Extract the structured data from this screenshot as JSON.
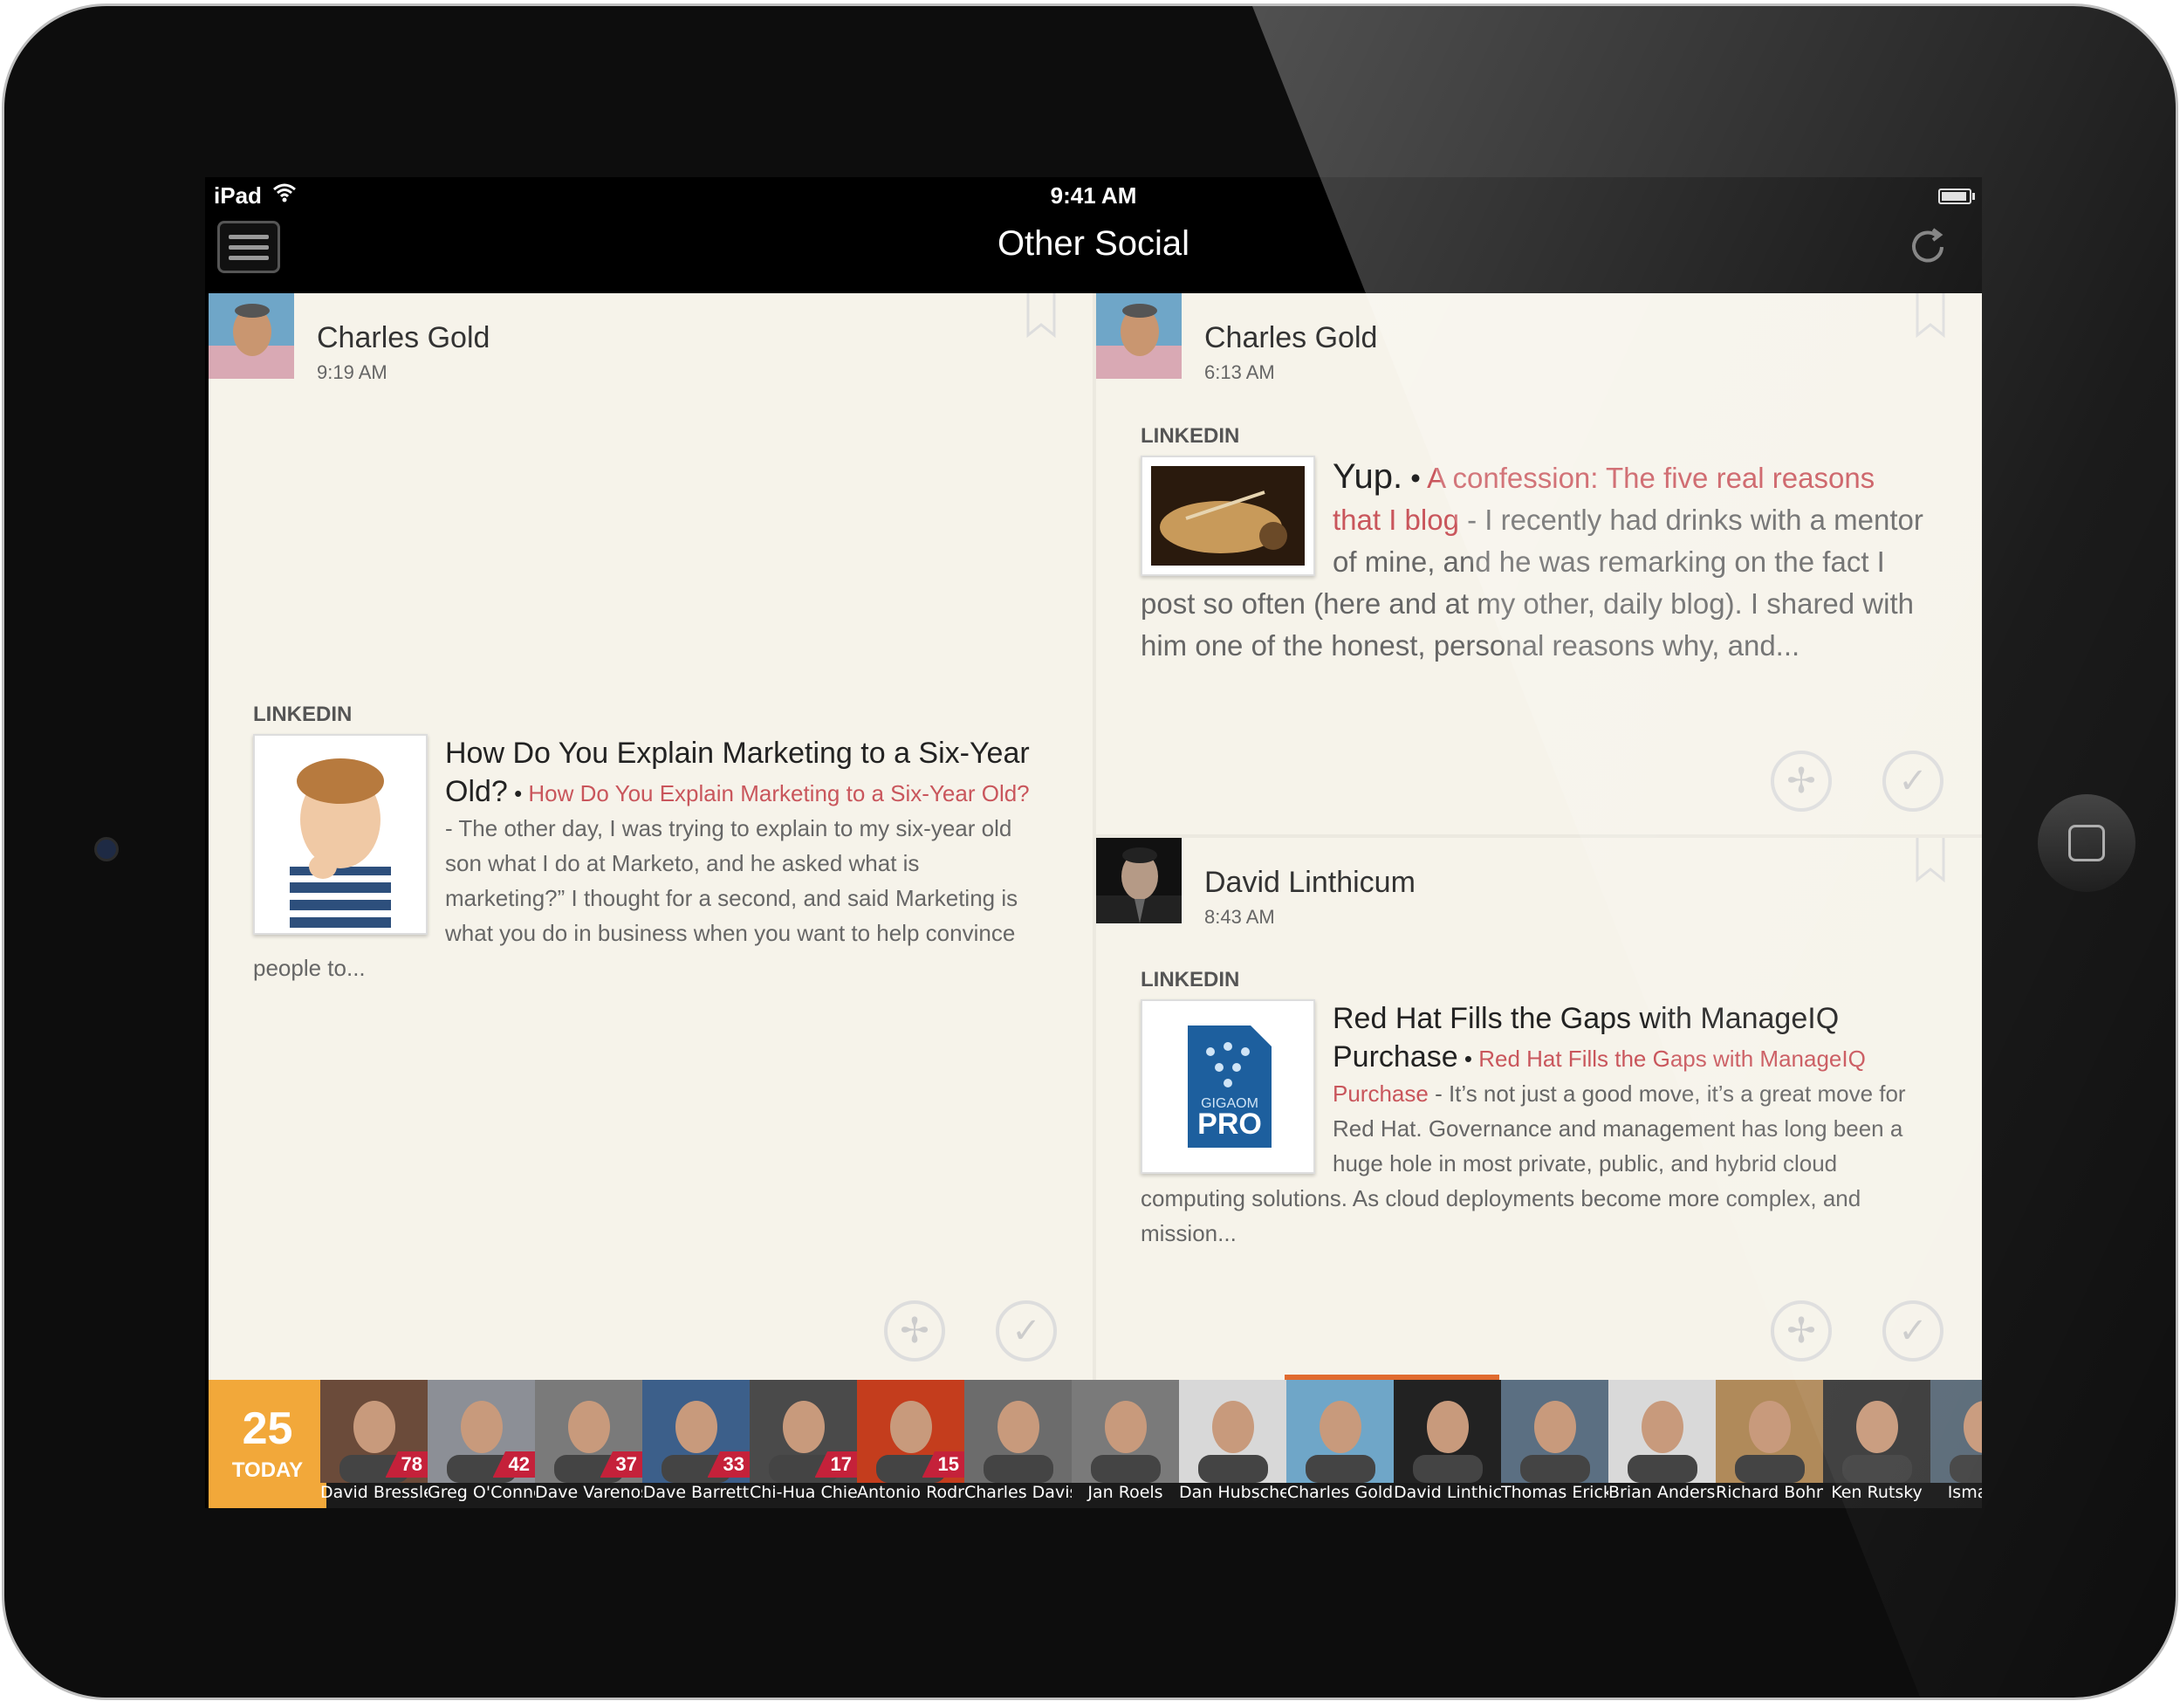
{
  "status_bar": {
    "carrier": "iPad",
    "time": "9:41 AM"
  },
  "nav": {
    "title": "Other Social"
  },
  "posts": [
    {
      "author": "Charles Gold",
      "time": "9:19 AM",
      "source": "LINKEDIN",
      "title": "How Do You Explain Marketing to a Six-Year Old?",
      "link": "How Do You Explain Marketing to a Six-Year Old?",
      "excerpt": " - The other day, I was trying to explain to my six-year old son what I do at Marketo, and he asked what is marketing?” I thought for a second, and said Marketing is what you do in business when you want to help convince people to..."
    },
    {
      "author": "Charles Gold",
      "time": "6:13 AM",
      "source": "LINKEDIN",
      "title": "Yup.",
      "link": "A confession: The five real reasons that I blog",
      "excerpt": " - I recently had drinks with a mentor of mine, and he was remarking on the fact I post so often (here and at my other, daily blog). I shared with him one of the honest, personal reasons why, and..."
    },
    {
      "author": "David Linthicum",
      "time": "8:43 AM",
      "source": "LINKEDIN",
      "title": "Red Hat Fills the Gaps with ManageIQ Purchase",
      "link": "Red Hat Fills the Gaps with ManageIQ Purchase",
      "excerpt": " - It’s not just a good move, it’s a great move for Red Hat. Governance and management has long been a huge hole in most private, public, and hybrid cloud computing solutions. As cloud deployments become more complex, and mission...",
      "thumb_text": {
        "brand": "GIGAOM",
        "product": "PRO"
      }
    }
  ],
  "today": {
    "count": "25",
    "label": "TODAY"
  },
  "contacts": [
    {
      "name": "David Bressler",
      "count": "78"
    },
    {
      "name": "Greg O'Connor",
      "count": "42"
    },
    {
      "name": "Dave Varenos",
      "count": "37"
    },
    {
      "name": "Dave Barrett",
      "count": "33"
    },
    {
      "name": "Chi-Hua Chien",
      "count": "17"
    },
    {
      "name": "Antonio Rodri...",
      "count": "15"
    },
    {
      "name": "Charles Davis",
      "count": ""
    },
    {
      "name": "Jan Roels",
      "count": ""
    },
    {
      "name": "Dan Hubscher",
      "count": ""
    },
    {
      "name": "Charles Gold",
      "count": ""
    },
    {
      "name": "David Linthicum",
      "count": ""
    },
    {
      "name": "Thomas Erickson",
      "count": ""
    },
    {
      "name": "Brian Anderson",
      "count": ""
    },
    {
      "name": "Richard Bohn",
      "count": ""
    },
    {
      "name": "Ken Rutsky",
      "count": ""
    },
    {
      "name": "Ismael O",
      "count": ""
    }
  ],
  "icons": {
    "menu": "hamburger-icon",
    "refresh": "refresh-icon",
    "bookmark": "bookmark-icon",
    "share": "share-icon",
    "done": "checkmark-icon"
  },
  "colors": {
    "accent_link": "#c9565c",
    "today_bg": "#f2a83a",
    "count_badge": "#c5213a",
    "selected_indicator": "#e06a2e"
  }
}
